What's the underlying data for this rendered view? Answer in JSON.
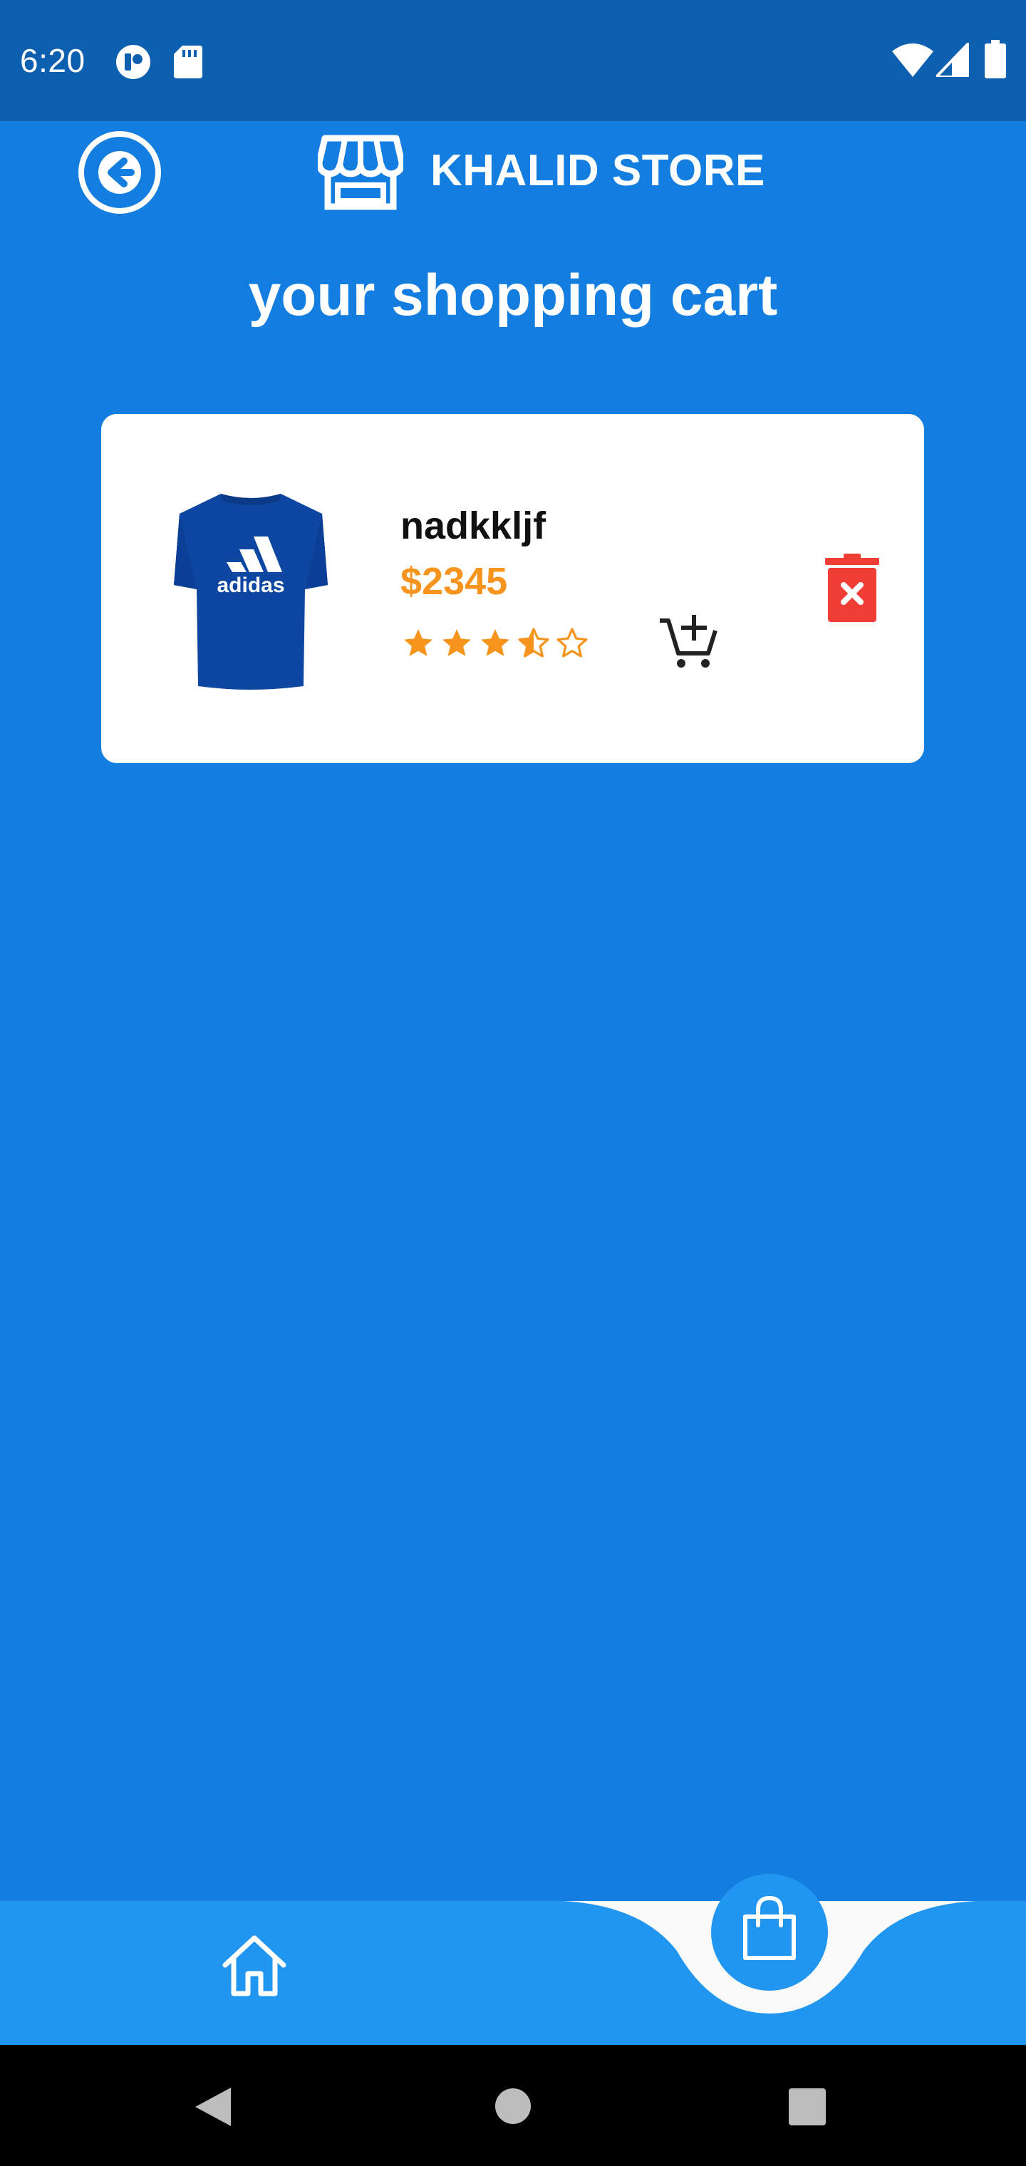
{
  "status_bar": {
    "time": "6:20",
    "icons": [
      "notification-app-icon",
      "sd-card-icon",
      "wifi-icon",
      "signal-icon",
      "battery-icon"
    ]
  },
  "header": {
    "store_name": "KHALID STORE",
    "back_icon": "arrow-left-circle-icon",
    "store_icon": "storefront-icon"
  },
  "page": {
    "title": "your shopping cart"
  },
  "cart": {
    "items": [
      {
        "name": "nadkkljf",
        "price": "$2345",
        "rating": 3.5,
        "rating_max": 5,
        "image": "blue-adidas-tshirt",
        "image_logo_text": "adidas"
      }
    ]
  },
  "bottom_nav": {
    "items": [
      {
        "icon": "home-icon",
        "active": false
      },
      {
        "icon": "shopping-bag-icon",
        "active": true
      }
    ]
  },
  "colors": {
    "background": "#137ee0",
    "status_bar": "#0d5faf",
    "nav_bar": "#2196f0",
    "price": "#f7941d",
    "star": "#f7941d",
    "delete": "#f03e36",
    "card": "#ffffff"
  }
}
